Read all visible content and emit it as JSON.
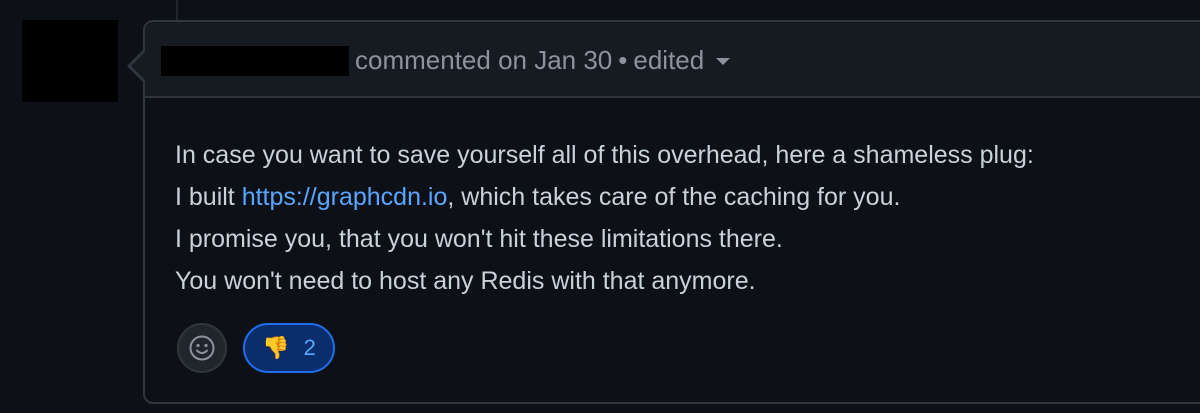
{
  "comment": {
    "header": {
      "action": "commented on Jan 30",
      "separator": "•",
      "edited_label": "edited"
    },
    "body": {
      "line1": "In case you want to save yourself all of this overhead, here a shameless plug:",
      "line2_prefix": "I built ",
      "line2_link": "https://graphcdn.io",
      "line2_suffix": ", which takes care of the caching for you.",
      "line3": "I promise you, that you won't hit these limitations there.",
      "line4": "You won't need to host any Redis with that anymore."
    },
    "reactions": {
      "add_icon": "smiley-icon",
      "items": [
        {
          "icon": "thumbs-down-icon",
          "emoji": "👎",
          "count": "2"
        }
      ]
    }
  },
  "colors": {
    "background": "#0d1117",
    "header_bg": "#161b22",
    "border": "#30363d",
    "text": "#c9d1d9",
    "muted": "#8b949e",
    "link": "#58a6ff",
    "reaction_bg": "#0c2d6b",
    "reaction_border": "#1f6feb"
  }
}
